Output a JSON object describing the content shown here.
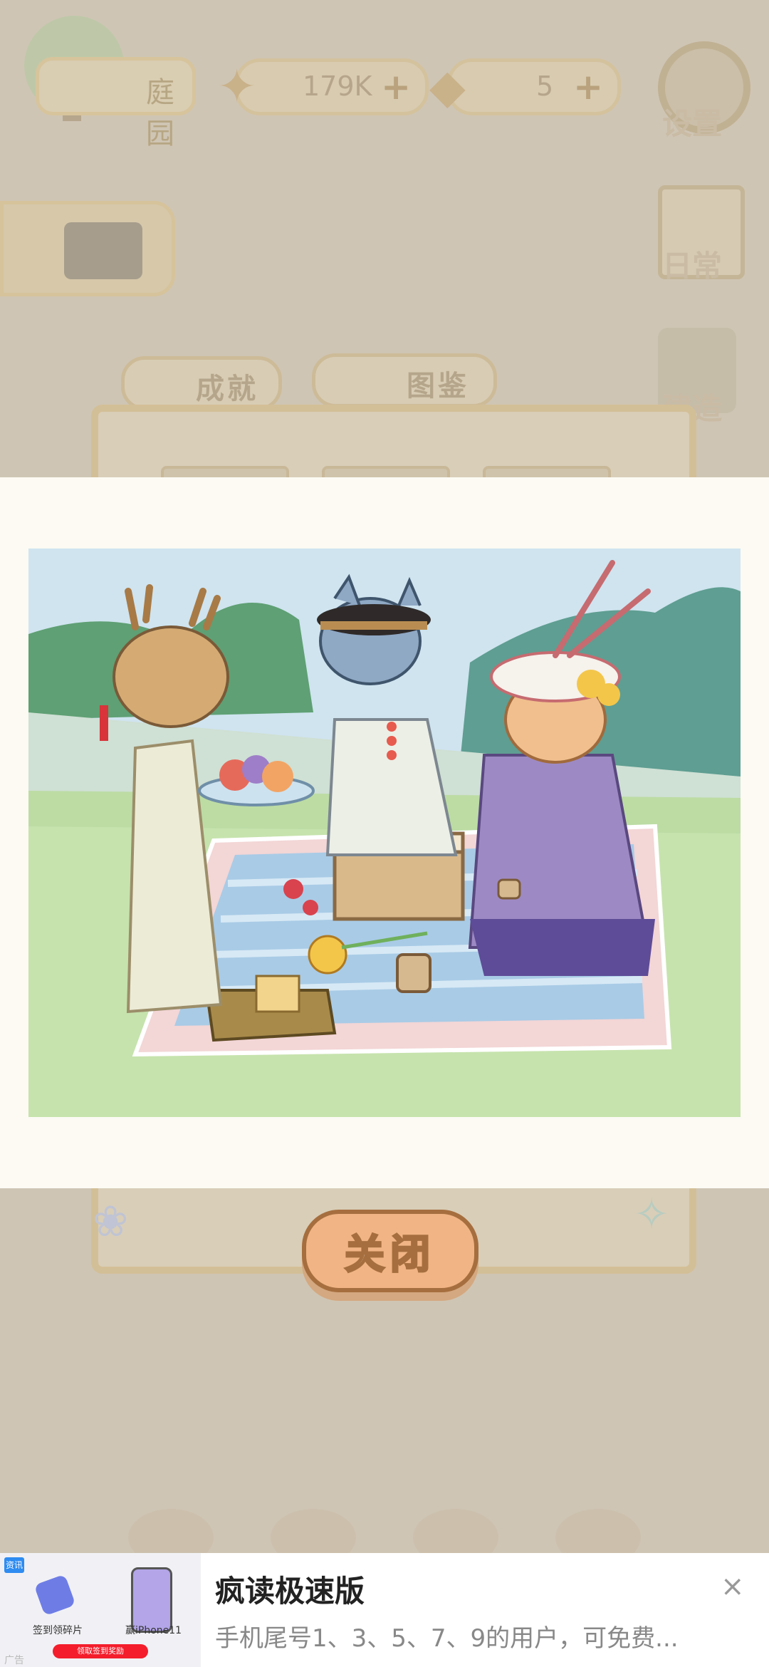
{
  "hud": {
    "home_label": "庭园",
    "fish_value": "179K",
    "cake_value": "5",
    "settings_label": "设置",
    "daily_label": "日常",
    "build_label": "建造"
  },
  "tabs": {
    "achievement": "成就",
    "collection": "图鉴"
  },
  "popup": {
    "close_label": "关闭"
  },
  "ad": {
    "badge": "资讯",
    "caption_left": "签到领碎片",
    "caption_right": "赢iPhone11",
    "cta": "领取签到奖励",
    "ad_label": "广告",
    "title": "疯读极速版",
    "description": "手机尾号1、3、5、7、9的用户，可免费...",
    "close_icon": "×"
  },
  "colors": {
    "accent_orange": "#f1b585",
    "popup_bg": "#fcfaf3"
  }
}
